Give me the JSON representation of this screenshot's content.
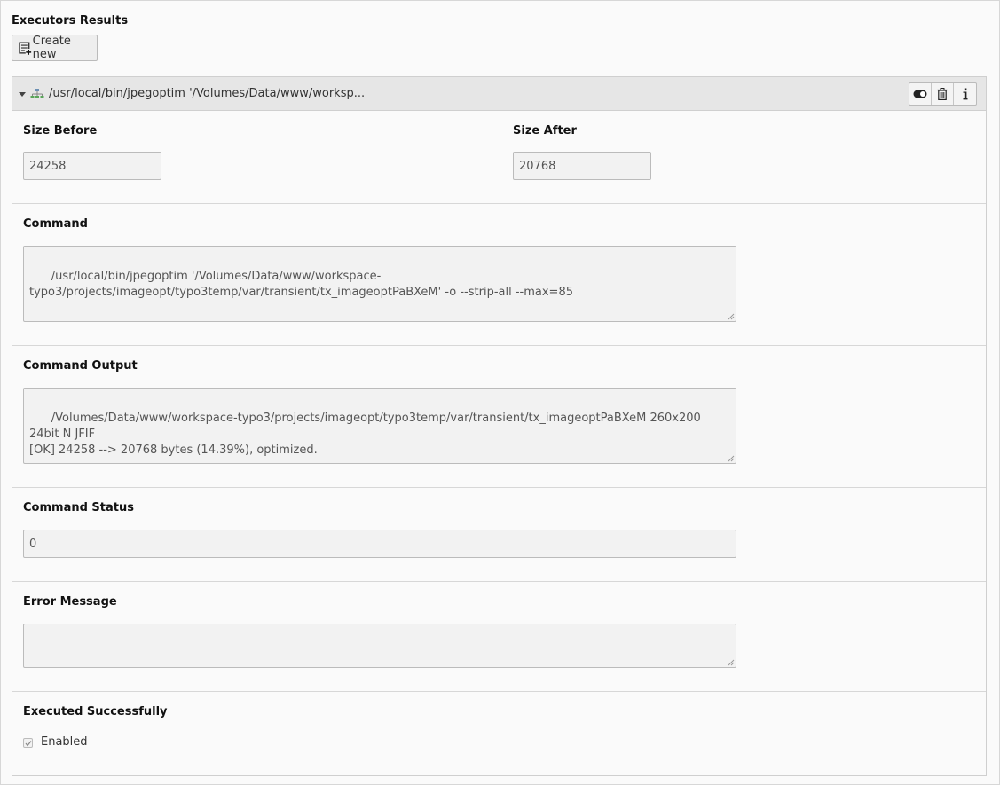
{
  "page": {
    "title": "Executors Results"
  },
  "toolbar": {
    "create_new_label": "Create new"
  },
  "record": {
    "title": "/usr/local/bin/jpegoptim '/Volumes/Data/www/worksp...",
    "controls": [
      "toggle-icon",
      "trash-icon",
      "info-icon"
    ]
  },
  "fields": {
    "size_before": {
      "label": "Size Before",
      "value": "24258"
    },
    "size_after": {
      "label": "Size After",
      "value": "20768"
    },
    "command": {
      "label": "Command",
      "value": "/usr/local/bin/jpegoptim '/Volumes/Data/www/workspace-\ntypo3/projects/imageopt/typo3temp/var/transient/tx_imageoptPaBXeM' -o --strip-all --max=85"
    },
    "command_output": {
      "label": "Command Output",
      "value": "/Volumes/Data/www/workspace-typo3/projects/imageopt/typo3temp/var/transient/tx_imageoptPaBXeM 260x200 24bit N JFIF\n[OK] 24258 --> 20768 bytes (14.39%), optimized."
    },
    "command_status": {
      "label": "Command Status",
      "value": "0"
    },
    "error_message": {
      "label": "Error Message",
      "value": ""
    },
    "executed_successfully": {
      "label": "Executed Successfully",
      "checkbox_label": "Enabled",
      "checked": true
    }
  }
}
